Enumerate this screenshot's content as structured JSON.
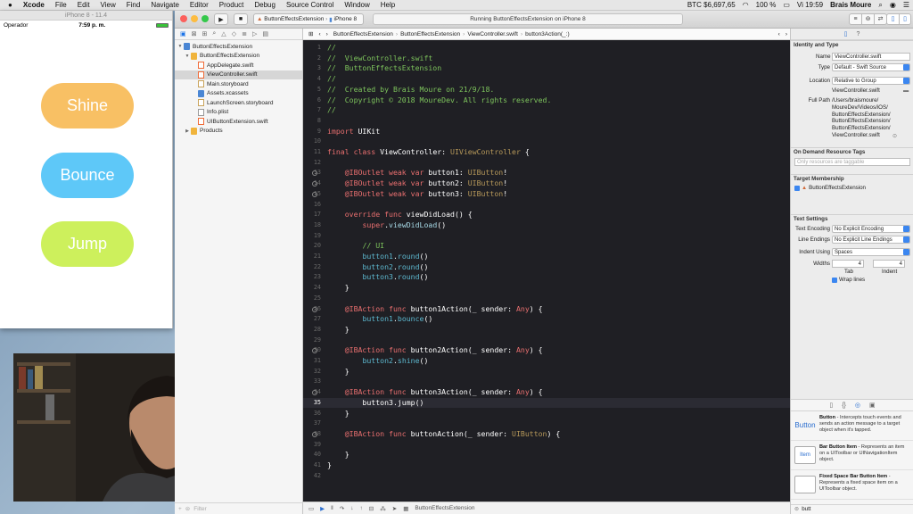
{
  "menubar": {
    "apple": "",
    "app": "Xcode",
    "menus": [
      "File",
      "Edit",
      "View",
      "Find",
      "Navigate",
      "Editor",
      "Product",
      "Debug",
      "Source Control",
      "Window",
      "Help"
    ],
    "btc": "BTC $6,697,65",
    "battery": "100 %",
    "clock": "Vi 19:59",
    "user": "Brais Moure"
  },
  "simulator": {
    "title": "iPhone 8 - 11.4",
    "carrier": "Operador",
    "time": "7:59 p. m.",
    "buttons": [
      {
        "label": "Shine",
        "color": "#f8c064"
      },
      {
        "label": "Bounce",
        "color": "#5ec8f8"
      },
      {
        "label": "Jump",
        "color": "#cdf05c"
      }
    ]
  },
  "toolbar": {
    "scheme": "ButtonEffectsExtension",
    "device": "iPhone 8",
    "status": "Running ButtonEffectsExtension on iPhone 8"
  },
  "navigator": {
    "filter_placeholder": "Filter",
    "items": [
      {
        "label": "ButtonEffectsExtension",
        "icon": "proj",
        "indent": 0,
        "disc": "▼"
      },
      {
        "label": "ButtonEffectsExtension",
        "icon": "folder",
        "indent": 1,
        "disc": "▼"
      },
      {
        "label": "AppDelegate.swift",
        "icon": "swift",
        "indent": 2,
        "disc": ""
      },
      {
        "label": "ViewController.swift",
        "icon": "swift",
        "indent": 2,
        "disc": "",
        "selected": true
      },
      {
        "label": "Main.storyboard",
        "icon": "sb",
        "indent": 2,
        "disc": ""
      },
      {
        "label": "Assets.xcassets",
        "icon": "asset",
        "indent": 2,
        "disc": ""
      },
      {
        "label": "LaunchScreen.storyboard",
        "icon": "sb",
        "indent": 2,
        "disc": ""
      },
      {
        "label": "Info.plist",
        "icon": "plist",
        "indent": 2,
        "disc": ""
      },
      {
        "label": "UIButtonExtension.swift",
        "icon": "swift",
        "indent": 2,
        "disc": ""
      },
      {
        "label": "Products",
        "icon": "folder",
        "indent": 1,
        "disc": "▶"
      }
    ]
  },
  "jumpbar": {
    "items": [
      "ButtonEffectsExtension",
      "ButtonEffectsExtension",
      "ViewController.swift",
      "button3Action(_:)"
    ]
  },
  "code": [
    {
      "n": "1",
      "t": [
        [
          "cm",
          "//"
        ]
      ]
    },
    {
      "n": "2",
      "t": [
        [
          "cm",
          "//  ViewController.swift"
        ]
      ]
    },
    {
      "n": "3",
      "t": [
        [
          "cm",
          "//  ButtonEffectsExtension"
        ]
      ]
    },
    {
      "n": "4",
      "t": [
        [
          "cm",
          "//"
        ]
      ]
    },
    {
      "n": "5",
      "t": [
        [
          "cm",
          "//  Created by Brais Moure on 21/9/18."
        ]
      ]
    },
    {
      "n": "6",
      "t": [
        [
          "cm",
          "//  Copyright © 2018 MoureDev. All rights reserved."
        ]
      ]
    },
    {
      "n": "7",
      "t": [
        [
          "cm",
          "//"
        ]
      ]
    },
    {
      "n": "8",
      "t": []
    },
    {
      "n": "9",
      "t": [
        [
          "kw",
          "import"
        ],
        [
          "pl",
          " UIKit"
        ]
      ]
    },
    {
      "n": "10",
      "t": []
    },
    {
      "n": "11",
      "t": [
        [
          "kw",
          "final class"
        ],
        [
          "pl",
          " ViewController: "
        ],
        [
          "ty",
          "UIViewController"
        ],
        [
          "pl",
          " {"
        ]
      ]
    },
    {
      "n": "12",
      "t": []
    },
    {
      "n": "13",
      "bp": true,
      "t": [
        [
          "pl",
          "    "
        ],
        [
          "kw",
          "@IBOutlet weak var"
        ],
        [
          "pl",
          " button1: "
        ],
        [
          "ty",
          "UIButton"
        ],
        [
          "pl",
          "!"
        ]
      ]
    },
    {
      "n": "14",
      "bp": true,
      "t": [
        [
          "pl",
          "    "
        ],
        [
          "kw",
          "@IBOutlet weak var"
        ],
        [
          "pl",
          " button2: "
        ],
        [
          "ty",
          "UIButton"
        ],
        [
          "pl",
          "!"
        ]
      ]
    },
    {
      "n": "15",
      "bp": true,
      "t": [
        [
          "pl",
          "    "
        ],
        [
          "kw",
          "@IBOutlet weak var"
        ],
        [
          "pl",
          " button3: "
        ],
        [
          "ty",
          "UIButton"
        ],
        [
          "pl",
          "!"
        ]
      ]
    },
    {
      "n": "16",
      "t": []
    },
    {
      "n": "17",
      "t": [
        [
          "pl",
          "    "
        ],
        [
          "kw",
          "override func"
        ],
        [
          "pl",
          " viewDidLoad() {"
        ]
      ]
    },
    {
      "n": "18",
      "t": [
        [
          "pl",
          "        "
        ],
        [
          "kw",
          "super"
        ],
        [
          "pl",
          "."
        ],
        [
          "me",
          "viewDidLoad"
        ],
        [
          "pl",
          "()"
        ]
      ]
    },
    {
      "n": "19",
      "t": []
    },
    {
      "n": "20",
      "t": [
        [
          "pl",
          "        "
        ],
        [
          "cm",
          "// UI"
        ]
      ]
    },
    {
      "n": "21",
      "t": [
        [
          "pl",
          "        "
        ],
        [
          "fn",
          "button1"
        ],
        [
          "pl",
          "."
        ],
        [
          "fn",
          "round"
        ],
        [
          "pl",
          "()"
        ]
      ]
    },
    {
      "n": "22",
      "t": [
        [
          "pl",
          "        "
        ],
        [
          "fn",
          "button2"
        ],
        [
          "pl",
          "."
        ],
        [
          "fn",
          "round"
        ],
        [
          "pl",
          "()"
        ]
      ]
    },
    {
      "n": "23",
      "t": [
        [
          "pl",
          "        "
        ],
        [
          "fn",
          "button3"
        ],
        [
          "pl",
          "."
        ],
        [
          "fn",
          "round"
        ],
        [
          "pl",
          "()"
        ]
      ]
    },
    {
      "n": "24",
      "t": [
        [
          "pl",
          "    }"
        ]
      ]
    },
    {
      "n": "25",
      "t": []
    },
    {
      "n": "26",
      "bp": true,
      "t": [
        [
          "pl",
          "    "
        ],
        [
          "kw",
          "@IBAction func"
        ],
        [
          "pl",
          " button1Action(_ sender: "
        ],
        [
          "kw",
          "Any"
        ],
        [
          "pl",
          ") {"
        ]
      ]
    },
    {
      "n": "27",
      "t": [
        [
          "pl",
          "        "
        ],
        [
          "fn",
          "button1"
        ],
        [
          "pl",
          "."
        ],
        [
          "fn",
          "bounce"
        ],
        [
          "pl",
          "()"
        ]
      ]
    },
    {
      "n": "28",
      "t": [
        [
          "pl",
          "    }"
        ]
      ]
    },
    {
      "n": "29",
      "t": []
    },
    {
      "n": "30",
      "bp": true,
      "t": [
        [
          "pl",
          "    "
        ],
        [
          "kw",
          "@IBAction func"
        ],
        [
          "pl",
          " button2Action(_ sender: "
        ],
        [
          "kw",
          "Any"
        ],
        [
          "pl",
          ") {"
        ]
      ]
    },
    {
      "n": "31",
      "t": [
        [
          "pl",
          "        "
        ],
        [
          "fn",
          "button2"
        ],
        [
          "pl",
          "."
        ],
        [
          "fn",
          "shine"
        ],
        [
          "pl",
          "()"
        ]
      ]
    },
    {
      "n": "32",
      "t": [
        [
          "pl",
          "    }"
        ]
      ]
    },
    {
      "n": "33",
      "t": []
    },
    {
      "n": "34",
      "bp": true,
      "t": [
        [
          "pl",
          "    "
        ],
        [
          "kw",
          "@IBAction func"
        ],
        [
          "pl",
          " button3Action(_ sender: "
        ],
        [
          "kw",
          "Any"
        ],
        [
          "pl",
          ") {"
        ]
      ]
    },
    {
      "n": "35",
      "cur": true,
      "t": [
        [
          "pl",
          "        button3.jump()"
        ]
      ]
    },
    {
      "n": "36",
      "t": [
        [
          "pl",
          "    }"
        ]
      ]
    },
    {
      "n": "37",
      "t": []
    },
    {
      "n": "38",
      "bp": true,
      "t": [
        [
          "pl",
          "    "
        ],
        [
          "kw",
          "@IBAction func"
        ],
        [
          "pl",
          " buttonAction(_ sender: "
        ],
        [
          "ty",
          "UIButton"
        ],
        [
          "pl",
          ") {"
        ]
      ]
    },
    {
      "n": "39",
      "t": []
    },
    {
      "n": "40",
      "t": [
        [
          "pl",
          "    }"
        ]
      ]
    },
    {
      "n": "41",
      "t": [
        [
          "pl",
          "}"
        ]
      ]
    },
    {
      "n": "42",
      "t": []
    }
  ],
  "debugbar": {
    "target": "ButtonEffectsExtension"
  },
  "inspector": {
    "identity_title": "Identity and Type",
    "name_label": "Name",
    "name_value": "ViewController.swift",
    "type_label": "Type",
    "type_value": "Default - Swift Source",
    "location_label": "Location",
    "location_value": "Relative to Group",
    "location_file": "ViewController.swift",
    "fullpath_label": "Full Path",
    "fullpath_lines": [
      "/Users/braismoure/",
      "MoureDev/Videos/iOS/",
      "ButtonEffectsExtension/",
      "ButtonEffectsExtension/",
      "ButtonEffectsExtension/",
      "ViewController.swift"
    ],
    "odr_title": "On Demand Resource Tags",
    "odr_placeholder": "Only resources are taggable",
    "target_title": "Target Membership",
    "target_item": "ButtonEffectsExtension",
    "text_title": "Text Settings",
    "encoding_label": "Text Encoding",
    "encoding_value": "No Explicit Encoding",
    "endings_label": "Line Endings",
    "endings_value": "No Explicit Line Endings",
    "indent_label": "Indent Using",
    "indent_value": "Spaces",
    "widths_label": "Widths",
    "tab_value": "4",
    "indent_width_value": "4",
    "tab_label": "Tab",
    "indent_sub_label": "Indent",
    "wrap_label": "Wrap lines"
  },
  "library": {
    "items": [
      {
        "icon": "Button",
        "name": "Button",
        "desc": " - Intercepts touch events and sends an action message to a target object when it's tapped."
      },
      {
        "icon": "Item",
        "name": "Bar Button Item",
        "desc": " - Represents an item on a UIToolbar or UINavigationItem object."
      },
      {
        "icon": "",
        "name": "Fixed Space Bar Button Item",
        "desc": " - Represents a fixed space item on a UIToolbar object."
      }
    ],
    "search_value": "butt"
  }
}
